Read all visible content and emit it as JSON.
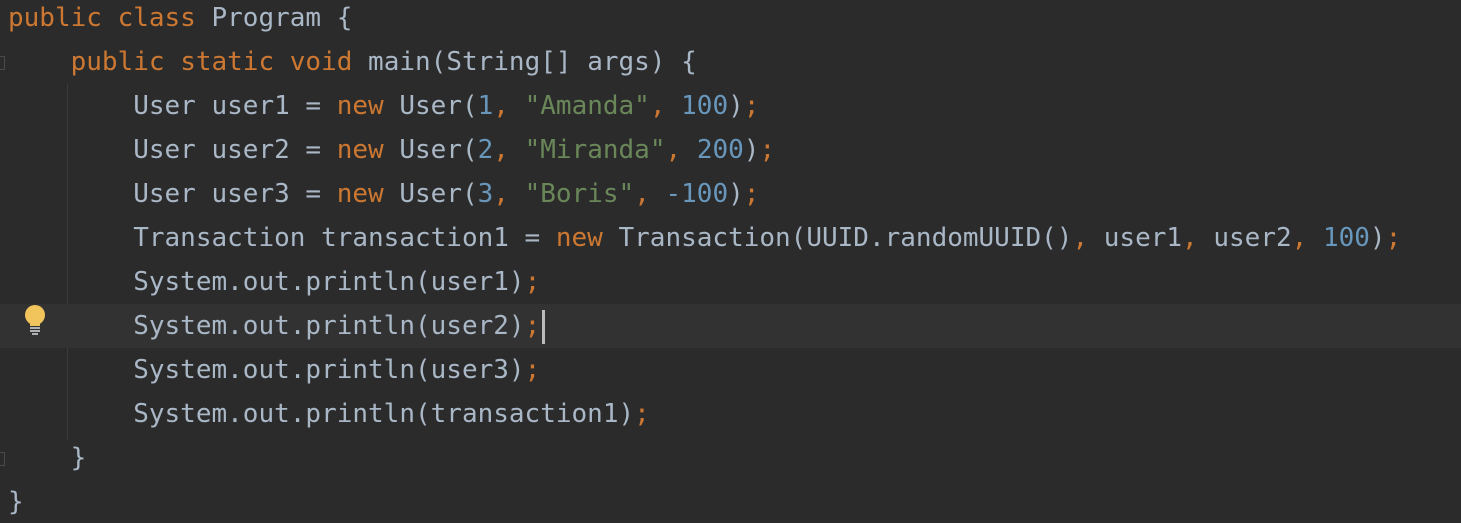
{
  "editor": {
    "language": "Java",
    "theme_colors": {
      "background": "#2b2b2b",
      "current_line": "#323232",
      "keyword": "#cc7832",
      "string": "#6a8759",
      "number": "#6897bb",
      "text": "#a9b7c6"
    },
    "current_line_index": 7,
    "intention_icon": "lightbulb-icon",
    "lines": [
      {
        "tokens": [
          {
            "t": "kw",
            "v": "public class "
          },
          {
            "t": "plain",
            "v": "Program {"
          }
        ]
      },
      {
        "tokens": [
          {
            "t": "plain",
            "v": "    "
          },
          {
            "t": "kw",
            "v": "public static void "
          },
          {
            "t": "plain",
            "v": "main(String[] args) {"
          }
        ]
      },
      {
        "tokens": [
          {
            "t": "plain",
            "v": "        User user1 = "
          },
          {
            "t": "kw",
            "v": "new "
          },
          {
            "t": "plain",
            "v": "User("
          },
          {
            "t": "num",
            "v": "1"
          },
          {
            "t": "punc",
            "v": ", "
          },
          {
            "t": "str",
            "v": "\"Amanda\""
          },
          {
            "t": "punc",
            "v": ", "
          },
          {
            "t": "num",
            "v": "100"
          },
          {
            "t": "plain",
            "v": ")"
          },
          {
            "t": "punc",
            "v": ";"
          }
        ]
      },
      {
        "tokens": [
          {
            "t": "plain",
            "v": "        User user2 = "
          },
          {
            "t": "kw",
            "v": "new "
          },
          {
            "t": "plain",
            "v": "User("
          },
          {
            "t": "num",
            "v": "2"
          },
          {
            "t": "punc",
            "v": ", "
          },
          {
            "t": "str",
            "v": "\"Miranda\""
          },
          {
            "t": "punc",
            "v": ", "
          },
          {
            "t": "num",
            "v": "200"
          },
          {
            "t": "plain",
            "v": ")"
          },
          {
            "t": "punc",
            "v": ";"
          }
        ]
      },
      {
        "tokens": [
          {
            "t": "plain",
            "v": "        User user3 = "
          },
          {
            "t": "kw",
            "v": "new "
          },
          {
            "t": "plain",
            "v": "User("
          },
          {
            "t": "num",
            "v": "3"
          },
          {
            "t": "punc",
            "v": ", "
          },
          {
            "t": "str",
            "v": "\"Boris\""
          },
          {
            "t": "punc",
            "v": ", "
          },
          {
            "t": "num",
            "v": "-100"
          },
          {
            "t": "plain",
            "v": ")"
          },
          {
            "t": "punc",
            "v": ";"
          }
        ]
      },
      {
        "tokens": [
          {
            "t": "plain",
            "v": "        Transaction transaction1 = "
          },
          {
            "t": "kw",
            "v": "new "
          },
          {
            "t": "plain",
            "v": "Transaction(UUID.randomUUID()"
          },
          {
            "t": "punc",
            "v": ", "
          },
          {
            "t": "plain",
            "v": "user1"
          },
          {
            "t": "punc",
            "v": ", "
          },
          {
            "t": "plain",
            "v": "user2"
          },
          {
            "t": "punc",
            "v": ", "
          },
          {
            "t": "num",
            "v": "100"
          },
          {
            "t": "plain",
            "v": ")"
          },
          {
            "t": "punc",
            "v": ";"
          }
        ]
      },
      {
        "tokens": [
          {
            "t": "plain",
            "v": "        System.out.println(user1)"
          },
          {
            "t": "punc",
            "v": ";"
          }
        ]
      },
      {
        "tokens": [
          {
            "t": "plain",
            "v": "        System.out.println(user2)"
          },
          {
            "t": "punc",
            "v": ";"
          }
        ]
      },
      {
        "tokens": [
          {
            "t": "plain",
            "v": "        System.out.println(user3)"
          },
          {
            "t": "punc",
            "v": ";"
          }
        ]
      },
      {
        "tokens": [
          {
            "t": "plain",
            "v": "        System.out.println(transaction1)"
          },
          {
            "t": "punc",
            "v": ";"
          }
        ]
      },
      {
        "tokens": [
          {
            "t": "plain",
            "v": "    }"
          }
        ]
      },
      {
        "tokens": [
          {
            "t": "plain",
            "v": "}"
          }
        ]
      }
    ]
  }
}
